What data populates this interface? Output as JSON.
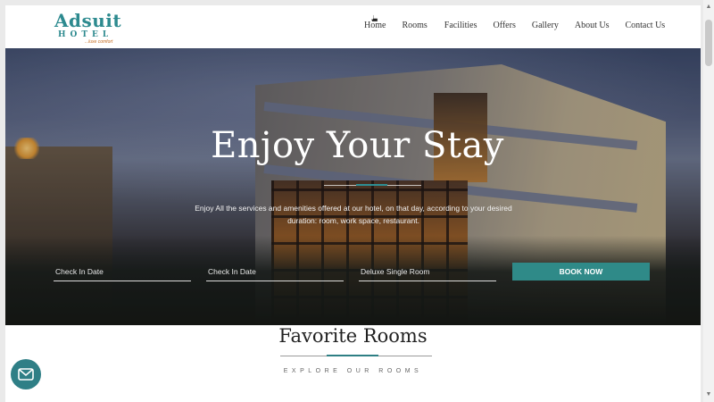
{
  "header": {
    "logo": {
      "wordmark": "Adsuit",
      "line2": "HOTEL",
      "tagline": "...luxe comfort"
    },
    "nav": [
      {
        "label": "Home"
      },
      {
        "label": "Rooms"
      },
      {
        "label": "Facilities"
      },
      {
        "label": "Offers"
      },
      {
        "label": "Gallery"
      },
      {
        "label": "About Us"
      },
      {
        "label": "Contact Us"
      }
    ]
  },
  "hero": {
    "title": "Enjoy Your Stay",
    "description": "Enjoy All the services and amenities offered at our hotel, on that day, according to your desired duration: room, work space, restaurant.",
    "booking": {
      "check_in_placeholder": "Check In Date",
      "check_out_placeholder": "Check In Date",
      "room_type": "Deluxe Single Room",
      "button_label": "BOOK NOW"
    }
  },
  "favorites": {
    "title": "Favorite Rooms",
    "subtitle": "EXPLORE OUR ROOMS"
  },
  "colors": {
    "accent": "#2f8a88",
    "text_dark": "#333333",
    "chat_button": "#2f7f86"
  },
  "icons": {
    "chat": "mail-icon",
    "cursor": "hand-cursor-icon"
  }
}
